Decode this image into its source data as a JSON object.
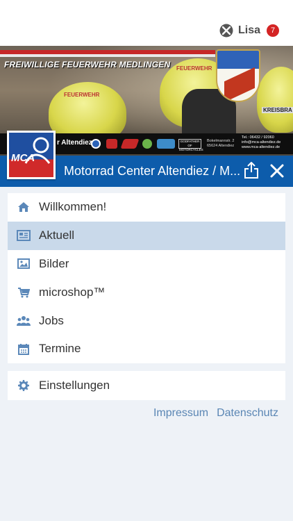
{
  "user": {
    "name": "Lisa",
    "badge_count": "7"
  },
  "banner": {
    "title": "FREIWILLIGE FEUERWEHR MEDLINGEN",
    "helmet_label": "FEUERWEHR",
    "kreis_label": "KREISBRA",
    "sponsor_name": "r Altendiez",
    "sponsor_badge": "GODFATHER OF MOTORCYCLES",
    "sponsor_address": "Bokelmannstr. 2 65624 Altendiez",
    "sponsor_contact": "Tel.: 06432 / 92060 info@mca-altendiez.de www.mca-altendiez.de"
  },
  "avatar": {
    "text": "MCA"
  },
  "appbar": {
    "title": "Motorrad Center Altendiez / M..."
  },
  "menu": {
    "items": [
      {
        "label": "Willkommen!",
        "icon": "home-icon"
      },
      {
        "label": "Aktuell",
        "icon": "newspaper-icon",
        "active": true
      },
      {
        "label": "Bilder",
        "icon": "image-icon"
      },
      {
        "label": "microshop™",
        "icon": "cart-icon"
      },
      {
        "label": "Jobs",
        "icon": "users-icon"
      },
      {
        "label": "Termine",
        "icon": "calendar-icon"
      }
    ]
  },
  "settings": {
    "label": "Einstellungen",
    "icon": "gear-icon"
  },
  "footer": {
    "impressum": "Impressum",
    "datenschutz": "Datenschutz"
  },
  "colors": {
    "primary": "#0d5cab",
    "active_row": "#c9d9ea",
    "icon": "#5b88b9",
    "badge": "#d42424",
    "link": "#5a86b4"
  }
}
